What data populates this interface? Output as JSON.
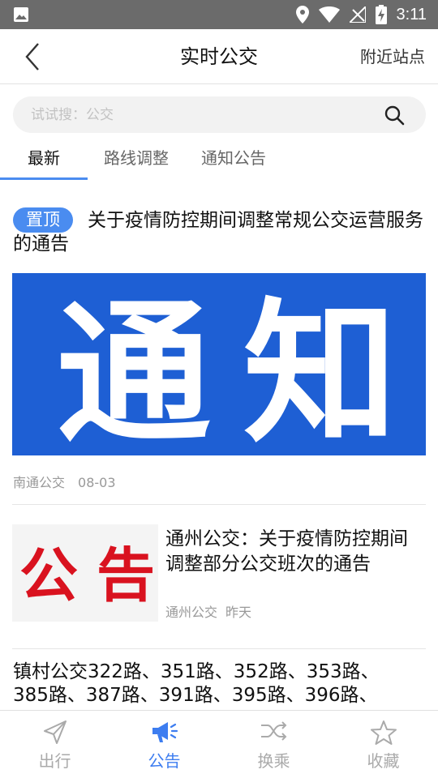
{
  "status_bar": {
    "time": "3:11"
  },
  "header": {
    "title": "实时公交",
    "nearby_label": "附近站点"
  },
  "search": {
    "placeholder": "试试搜：公交"
  },
  "tabs": [
    {
      "label": "最新",
      "active": true
    },
    {
      "label": "路线调整",
      "active": false
    },
    {
      "label": "通知公告",
      "active": false
    }
  ],
  "articles": [
    {
      "badge": "置顶",
      "title": "关于疫情防控期间调整常规公交运营服务的通告",
      "image_text_1": "通",
      "image_text_2": "知",
      "source": "南通公交",
      "date": "08-03"
    },
    {
      "title": "通州公交：关于疫情防控期间调整部分公交班次的通告",
      "image_text_1": "公",
      "image_text_2": "告",
      "source": "通州公交",
      "date": "昨天"
    },
    {
      "title_line_1": "镇村公交322路、351路、352路、353路、",
      "title_line_2": "385路、387路、391路、395路、396路、"
    }
  ],
  "bottom_nav": [
    {
      "label": "出行",
      "icon": "navigation-arrow-icon",
      "active": false
    },
    {
      "label": "公告",
      "icon": "megaphone-icon",
      "active": true
    },
    {
      "label": "换乘",
      "icon": "shuffle-icon",
      "active": false
    },
    {
      "label": "收藏",
      "icon": "star-icon",
      "active": false
    }
  ],
  "colors": {
    "accent": "#3d7df0",
    "status_bar": "#6b6b6b",
    "banner_blue": "#1e5fd4",
    "notice_red": "#d9121f"
  }
}
